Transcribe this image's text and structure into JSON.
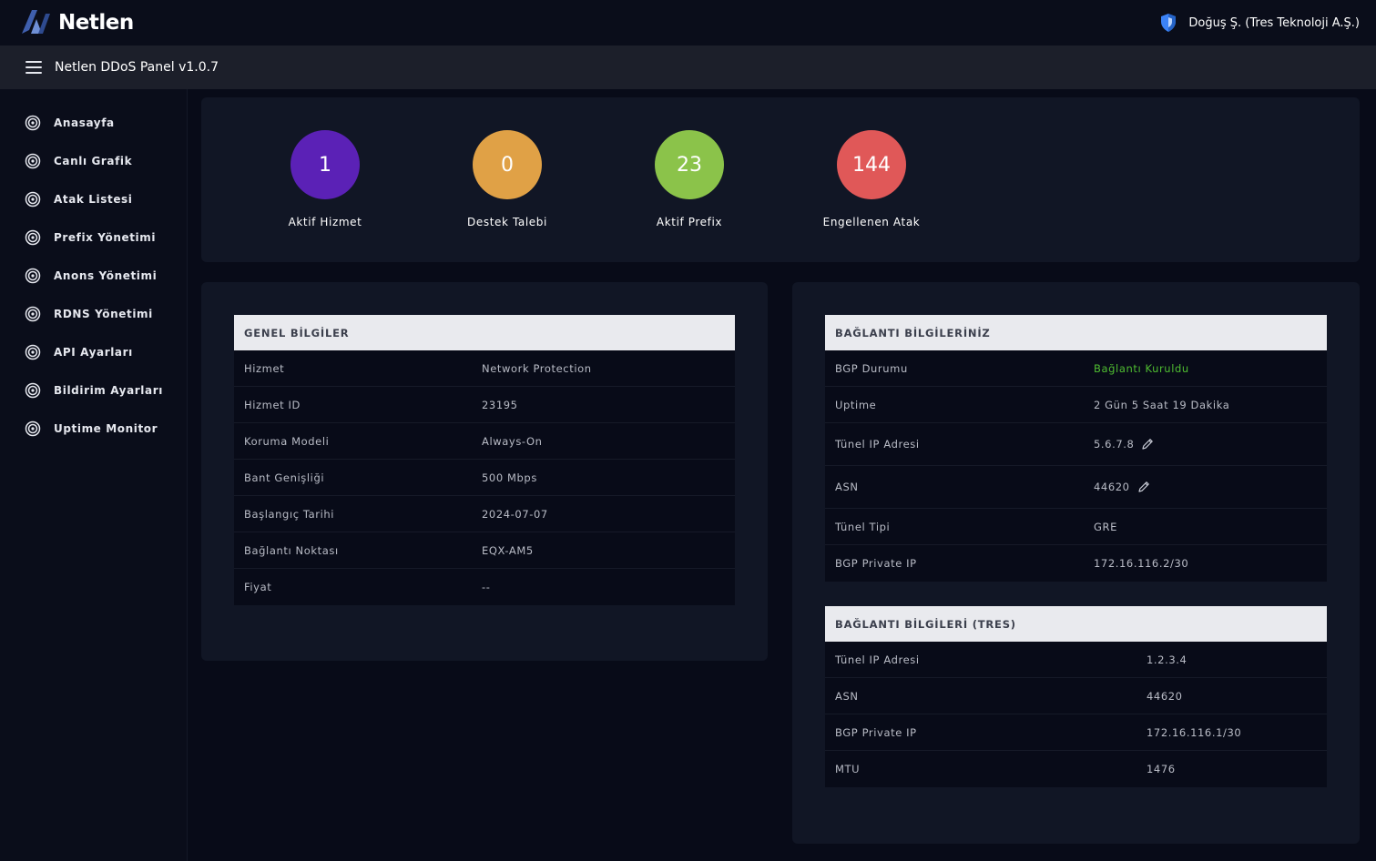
{
  "brand": {
    "name": "Netlen"
  },
  "user": {
    "name": "Doğuş Ş. (Tres Teknoloji A.Ş.)",
    "icon": "shield-icon"
  },
  "panel": {
    "title": "Netlen DDoS Panel v1.0.7"
  },
  "sidebar": {
    "items": [
      {
        "label": "Anasayfa",
        "icon": "target-icon"
      },
      {
        "label": "Canlı Grafik",
        "icon": "target-icon"
      },
      {
        "label": "Atak Listesi",
        "icon": "target-icon"
      },
      {
        "label": "Prefix Yönetimi",
        "icon": "target-icon"
      },
      {
        "label": "Anons Yönetimi",
        "icon": "target-icon"
      },
      {
        "label": "RDNS Yönetimi",
        "icon": "target-icon"
      },
      {
        "label": "API Ayarları",
        "icon": "target-icon"
      },
      {
        "label": "Bildirim Ayarları",
        "icon": "target-icon"
      },
      {
        "label": "Uptime Monitor",
        "icon": "target-icon"
      }
    ]
  },
  "stats": [
    {
      "value": "1",
      "label": "Aktif Hizmet",
      "color": "#5b21b6"
    },
    {
      "value": "0",
      "label": "Destek Talebi",
      "color": "#e0a146"
    },
    {
      "value": "23",
      "label": "Aktif Prefix",
      "color": "#8bc34a"
    },
    {
      "value": "144",
      "label": "Engellenen Atak",
      "color": "#e05858"
    }
  ],
  "general": {
    "title": "GENEL BİLGİLER",
    "rows": [
      {
        "key": "Hizmet",
        "value": "Network Protection"
      },
      {
        "key": "Hizmet ID",
        "value": "23195"
      },
      {
        "key": "Koruma Modeli",
        "value": "Always-On"
      },
      {
        "key": "Bant Genişliği",
        "value": "500 Mbps"
      },
      {
        "key": "Başlangıç Tarihi",
        "value": "2024-07-07"
      },
      {
        "key": "Bağlantı Noktası",
        "value": "EQX-AM5"
      },
      {
        "key": "Fiyat",
        "value": "--"
      }
    ]
  },
  "connection": {
    "title": "BAĞLANTI BİLGİLERİNİZ",
    "rows": [
      {
        "key": "BGP Durumu",
        "value": "Bağlantı Kuruldu"
      },
      {
        "key": "Uptime",
        "value": "2 Gün 5 Saat 19 Dakika"
      },
      {
        "key": "Tünel IP Adresi",
        "value": "5.6.7.8"
      },
      {
        "key": "ASN",
        "value": "44620"
      },
      {
        "key": "Tünel Tipi",
        "value": "GRE"
      },
      {
        "key": "BGP Private IP",
        "value": "172.16.116.2/30"
      }
    ]
  },
  "tres": {
    "title": "BAĞLANTI BİLGİLERİ (TRES)",
    "rows": [
      {
        "key": "Tünel IP Adresi",
        "value": "1.2.3.4"
      },
      {
        "key": "ASN",
        "value": "44620"
      },
      {
        "key": "BGP Private IP",
        "value": "172.16.116.1/30"
      },
      {
        "key": "MTU",
        "value": "1476"
      }
    ]
  },
  "colors": {
    "status_ok": "#4fbd31",
    "accent": "#3b82f6"
  }
}
